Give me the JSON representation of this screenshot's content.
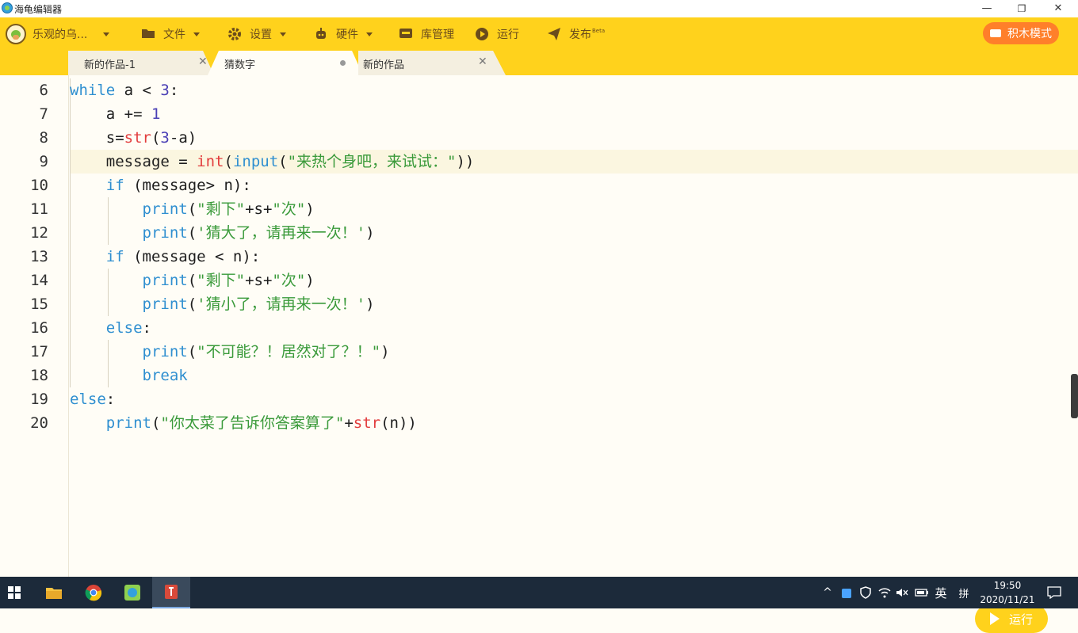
{
  "window": {
    "title": "海龟编辑器",
    "minimize": "—",
    "restore": "❐",
    "close": "✕"
  },
  "menu": {
    "user": "乐观的乌...",
    "file": "文件",
    "settings": "设置",
    "hardware": "硬件",
    "library": "库管理",
    "run": "运行",
    "publish": "发布",
    "publish_badge": "Beta",
    "blocks_mode": "积木模式"
  },
  "tabs": [
    {
      "label": "新的作品-1",
      "state": "close"
    },
    {
      "label": "猜数字",
      "state": "unsaved",
      "active": true
    },
    {
      "label": "新的作品",
      "state": "close"
    }
  ],
  "code": {
    "line_numbers": [
      "6",
      "7",
      "8",
      "9",
      "10",
      "11",
      "12",
      "13",
      "14",
      "15",
      "16",
      "17",
      "18",
      "19",
      "20"
    ],
    "current_line": "9",
    "lines": [
      "while a < 3:",
      "    a += 1",
      "    s=str(3-a)",
      "    message = int(input(\"来热个身吧，来试试：\"))",
      "    if (message> n):",
      "        print(\"剩下\"+s+\"次\")",
      "        print('猜大了，请再来一次！')",
      "    if (message < n):",
      "        print(\"剩下\"+s+\"次\")",
      "        print('猜小了，请再来一次！')",
      "    else:",
      "        print(\"不可能？！居然对了？！\")",
      "        break",
      "else:",
      "    print(\"你太菜了告诉你答案算了\"+str(n))"
    ]
  },
  "run_button": "运行",
  "taskbar": {
    "tray_arrow": "^",
    "ime": "英",
    "ime_grid": "拼",
    "time": "19:50",
    "date": "2020/11/21"
  },
  "colors": {
    "accent": "#ffd21c",
    "blocks_button": "#ff7f2a",
    "keyword": "#2f8fd0",
    "builtin_call": "#e23d3d",
    "string": "#3a9a3a",
    "number": "#4a3fb5"
  }
}
